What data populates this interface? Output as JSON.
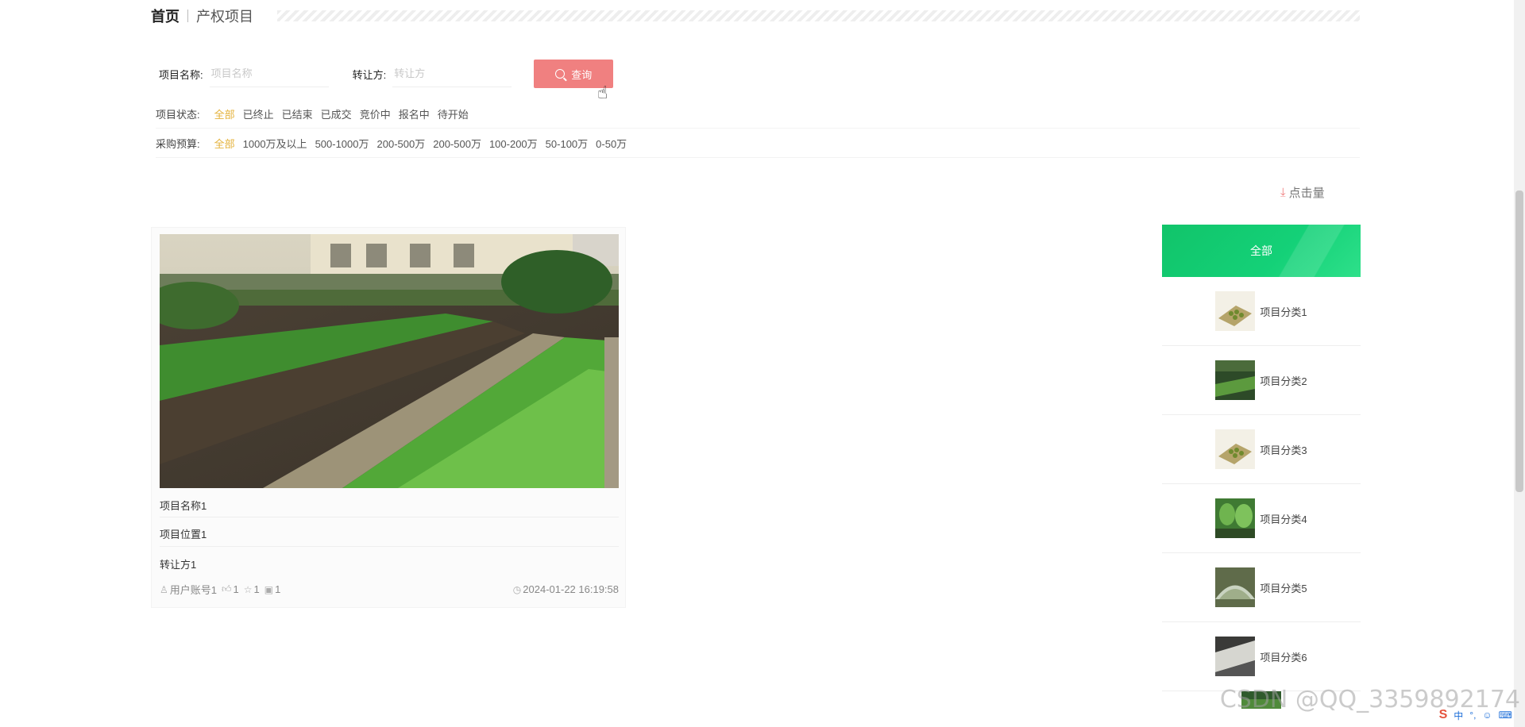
{
  "breadcrumb": {
    "home": "首页",
    "current": "产权项目"
  },
  "search": {
    "name_label": "项目名称:",
    "name_placeholder": "项目名称",
    "transferor_label": "转让方:",
    "transferor_placeholder": "转让方",
    "button_label": "查询"
  },
  "filters": {
    "status": {
      "label": "项目状态:",
      "options": [
        "全部",
        "已终止",
        "已结束",
        "已成交",
        "竞价中",
        "报名中",
        "待开始"
      ],
      "active": "全部"
    },
    "budget": {
      "label": "采购预算:",
      "options": [
        "全部",
        "1000万及以上",
        "500-1000万",
        "200-500万",
        "200-500万",
        "100-200万",
        "50-100万",
        "0-50万"
      ],
      "active": "全部"
    }
  },
  "sort": {
    "label": "点击量"
  },
  "card": {
    "name": "项目名称1",
    "location": "项目位置1",
    "transferor": "转让方1",
    "user": "用户账号1",
    "likes": "1",
    "favorites": "1",
    "comments": "1",
    "time": "2024-01-22 16:19:58"
  },
  "sidebar": {
    "all_label": "全部",
    "categories": [
      "项目分类1",
      "项目分类2",
      "项目分类3",
      "项目分类4",
      "项目分类5",
      "项目分类6"
    ]
  },
  "watermark": "CSDN @QQ_3359892174",
  "ime": {
    "lang": "中"
  },
  "colors": {
    "accent": "#f08080",
    "active": "#e4b23b",
    "green": "#11c46a"
  }
}
